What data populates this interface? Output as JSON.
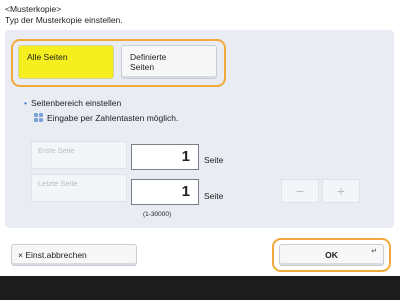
{
  "header": {
    "title": "<Musterkopie>",
    "subtitle": "Typ der Musterkopie einstellen."
  },
  "options": {
    "all_pages": "Alle Seiten",
    "defined_pages_line1": "Definierte",
    "defined_pages_line2": "Seiten"
  },
  "range": {
    "section_title": "Seitenbereich einstellen",
    "hint": "Eingabe per Zahlentasten möglich.",
    "first_page_label": "Erste Seite",
    "last_page_label": "Letzte Seite",
    "first_page_value": "1",
    "last_page_value": "1",
    "unit": "Seite",
    "limits": "(1-30000)"
  },
  "stepper": {
    "minus": "−",
    "plus": "+"
  },
  "footer": {
    "cancel": "Einst.abbrechen",
    "cancel_icon": "×",
    "ok": "OK",
    "ok_corner": "↵"
  },
  "colors": {
    "selected": "#f5ef1f",
    "focus_ring": "#f2a93b",
    "panel": "#e9ecf2"
  }
}
